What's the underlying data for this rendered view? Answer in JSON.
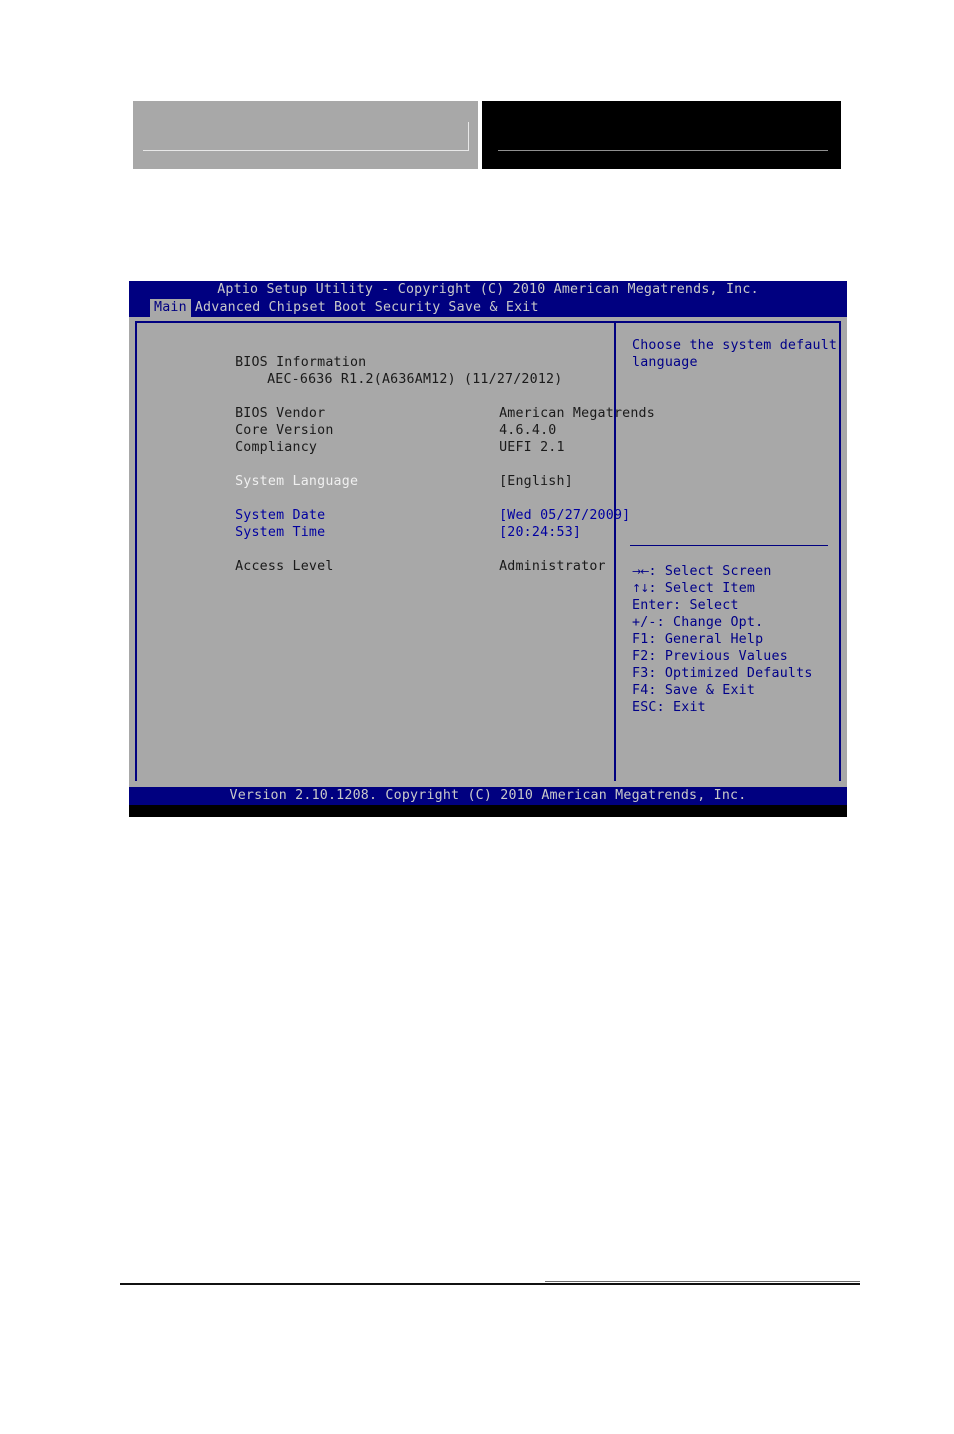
{
  "bios": {
    "title": "Aptio Setup Utility - Copyright (C) 2010 American Megatrends, Inc.",
    "tabs": [
      {
        "label": "Main",
        "selected": true
      },
      {
        "label": "Advanced",
        "selected": false
      },
      {
        "label": "Chipset",
        "selected": false
      },
      {
        "label": "Boot",
        "selected": false
      },
      {
        "label": "Security",
        "selected": false
      },
      {
        "label": "Save & Exit",
        "selected": false
      }
    ],
    "main": {
      "section_title": "BIOS Information",
      "bios_version": "AEC-6636 R1.2(A636AM12) (11/27/2012)",
      "fields": [
        {
          "label": "BIOS Vendor",
          "value": "American Megatrends"
        },
        {
          "label": "Core Version",
          "value": "4.6.4.0"
        },
        {
          "label": "Compliancy",
          "value": "UEFI 2.1"
        }
      ],
      "system_language": {
        "label": "System Language",
        "value": "[English]"
      },
      "system_date": {
        "label": "System Date",
        "value": "[Wed 05/27/2009]"
      },
      "system_time": {
        "label": "System Time",
        "value": "[20:24:53]"
      },
      "access_level": {
        "label": "Access Level",
        "value": "Administrator"
      }
    },
    "help": {
      "line1": "Choose the system default",
      "line2": "language"
    },
    "keys": [
      {
        "glyph": "→←",
        "text": ": Select Screen"
      },
      {
        "glyph": "↑↓",
        "text": ": Select Item"
      },
      {
        "glyph": "",
        "text": "Enter: Select"
      },
      {
        "glyph": "",
        "text": "+/-: Change Opt."
      },
      {
        "glyph": "",
        "text": "F1: General Help"
      },
      {
        "glyph": "",
        "text": "F2: Previous Values"
      },
      {
        "glyph": "",
        "text": "F3: Optimized Defaults"
      },
      {
        "glyph": "",
        "text": "F4: Save & Exit"
      },
      {
        "glyph": "",
        "text": "ESC: Exit"
      }
    ],
    "footer": "Version 2.10.1208. Copyright (C) 2010 American Megatrends, Inc."
  },
  "colors": {
    "bios_blue": "#000080",
    "bios_gray": "#a8a8a8",
    "highlight_blue": "#0000a0",
    "text_dark": "#1a1a1a",
    "text_light": "#c9c9c9"
  }
}
